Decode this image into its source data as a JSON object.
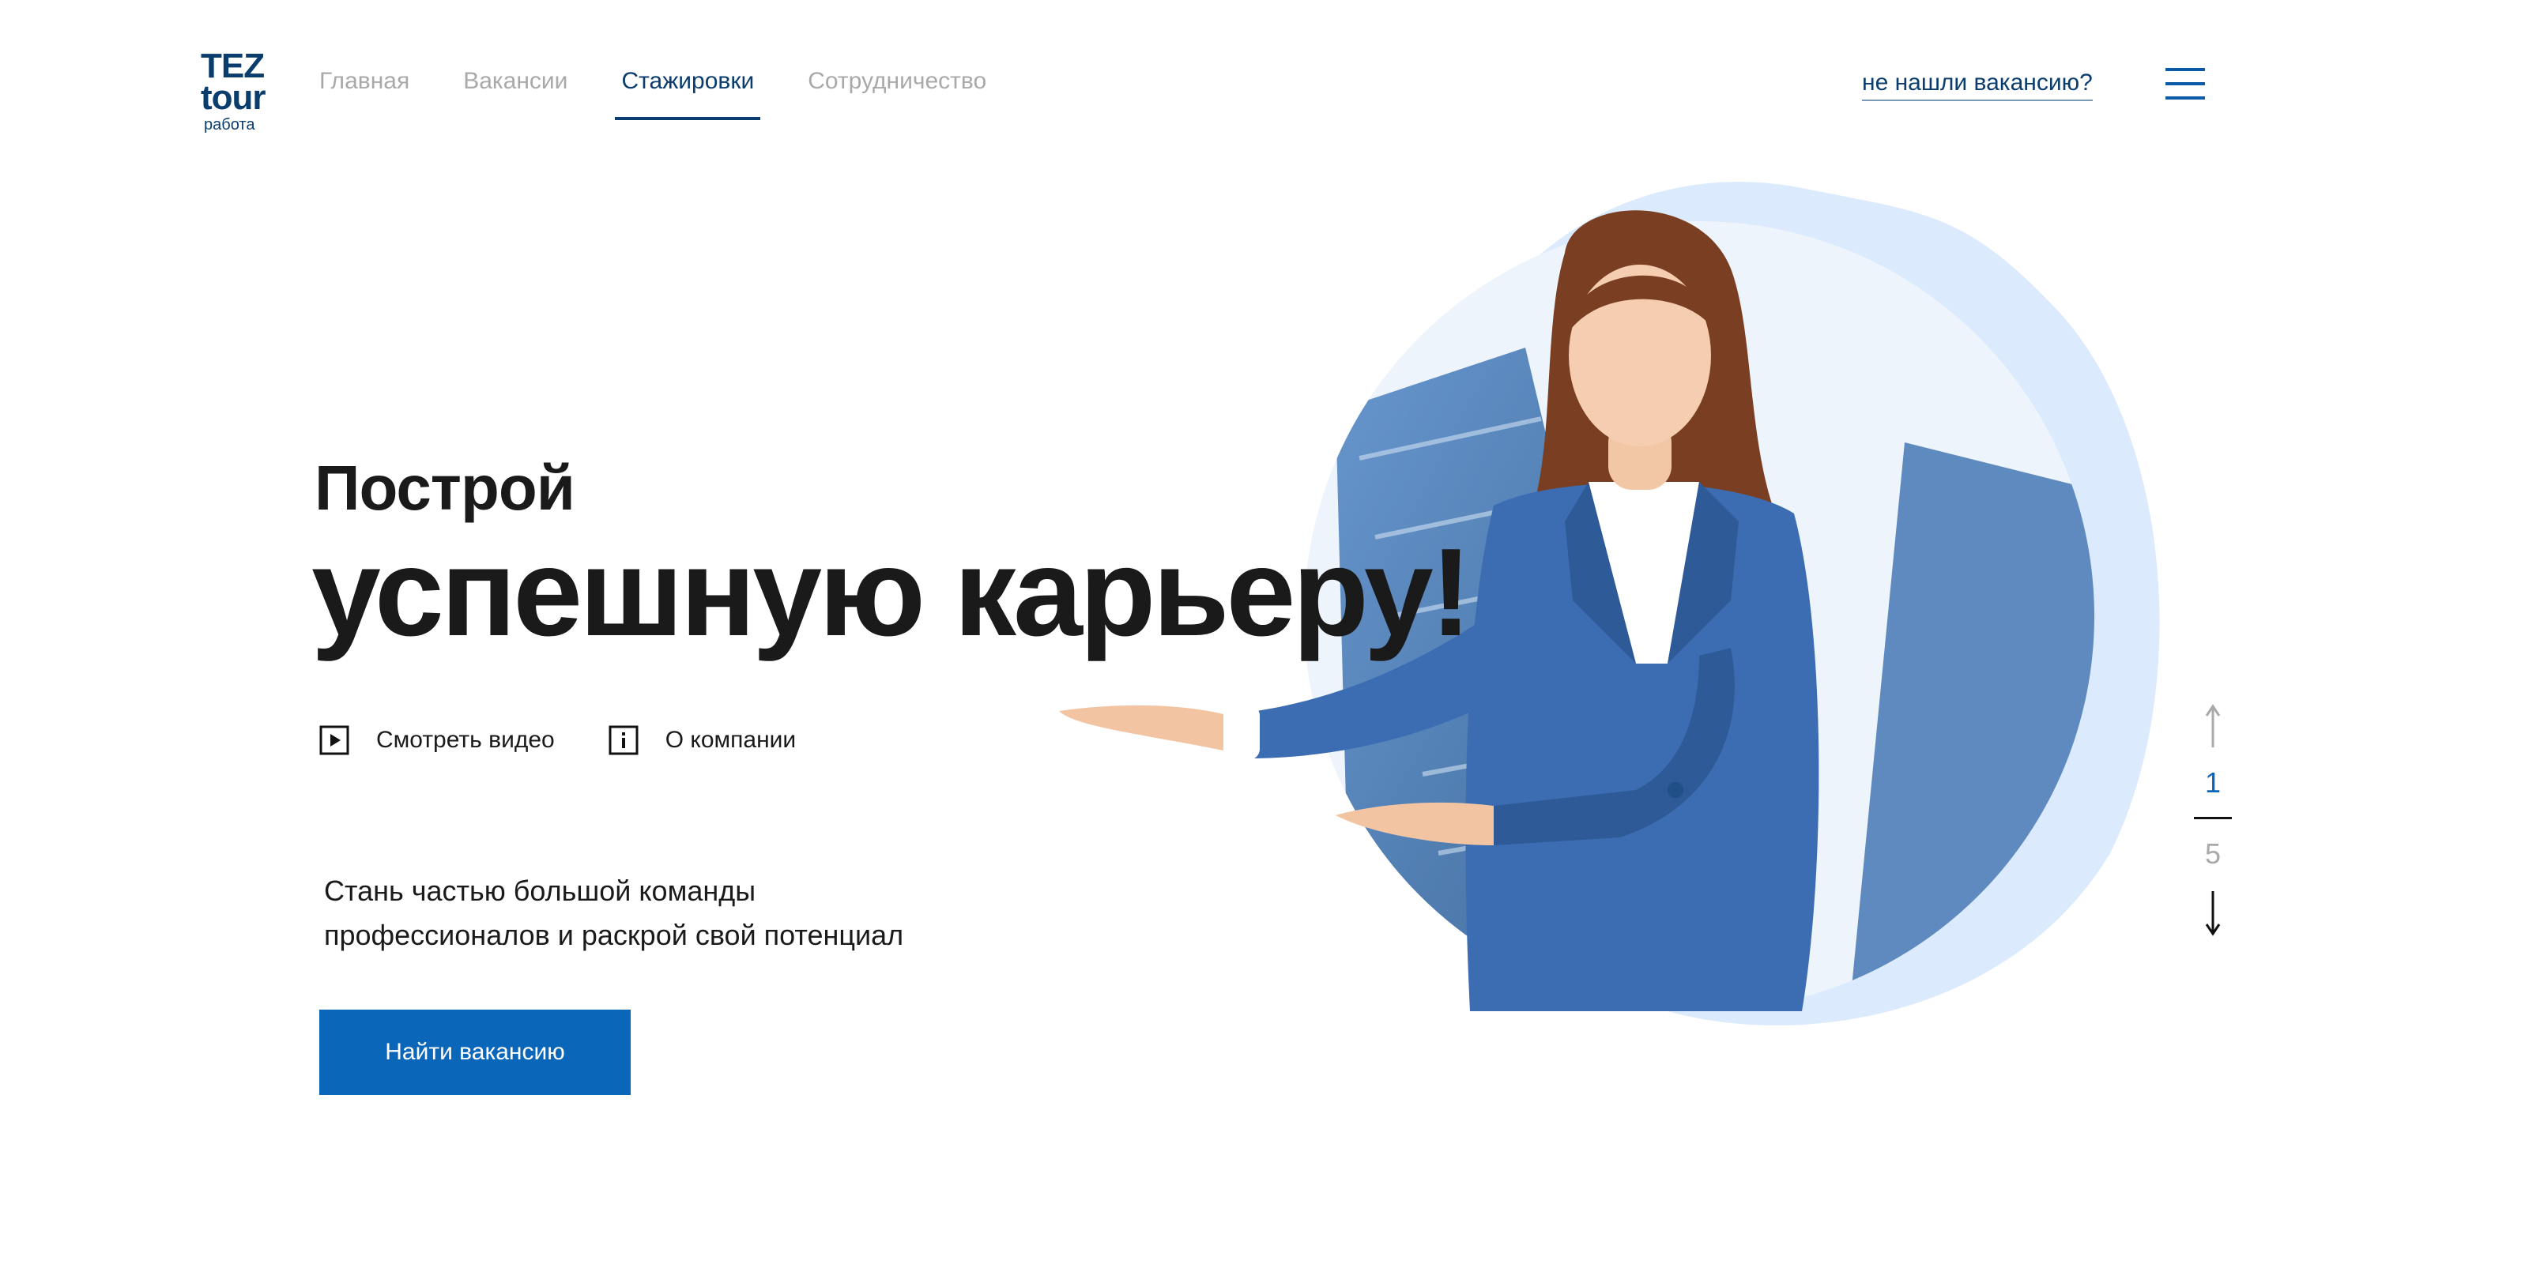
{
  "logo": {
    "line1": "TEZ",
    "line2": "tour",
    "line3": "работа"
  },
  "nav": {
    "items": [
      {
        "label": "Главная"
      },
      {
        "label": "Вакансии"
      },
      {
        "label": "Стажировки"
      },
      {
        "label": "Сотрудничество"
      }
    ],
    "active_index": 2
  },
  "header": {
    "not_found_link": "не нашли вакансию?",
    "menu_icon": "burger-menu-icon"
  },
  "hero": {
    "kicker": "Построй",
    "headline": "успешную карьеру!",
    "links": [
      {
        "label": "Смотреть видео",
        "icon": "play-icon"
      },
      {
        "label": "О компании",
        "icon": "info-icon"
      }
    ],
    "subtext_line1": "Стань частью большой команды",
    "subtext_line2": "профессионалов и раскрой свой потенциал",
    "cta": "Найти вакансию"
  },
  "pager": {
    "current": "1",
    "total": "5",
    "up_icon": "arrow-up-icon",
    "down_icon": "arrow-down-icon"
  },
  "colors": {
    "brand_dark": "#0a3d6e",
    "brand": "#0a66b8",
    "muted": "#a9a9a9",
    "blob": "#d6e8fb"
  }
}
